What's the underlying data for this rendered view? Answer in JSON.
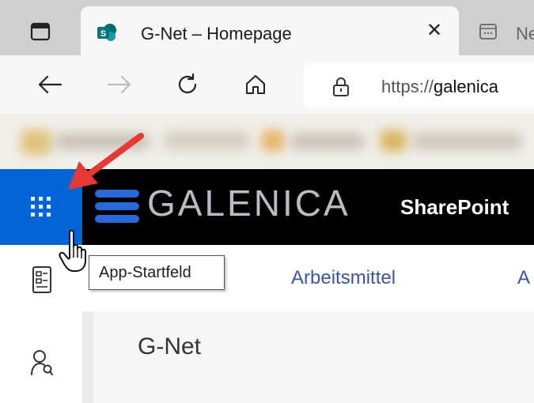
{
  "browser": {
    "tabs": [
      {
        "title": "G-Net – Homepage",
        "favicon": "sharepoint-icon",
        "active": true,
        "close": "✕"
      },
      {
        "title": "Ne",
        "favicon": "form-icon",
        "active": false
      }
    ],
    "address_bar": {
      "scheme": "https://",
      "host": "galenica",
      "icon": "lock-icon"
    },
    "nav_icons": [
      "back-arrow-icon",
      "forward-arrow-icon",
      "refresh-icon",
      "home-icon"
    ]
  },
  "suite_bar": {
    "brand": "GALENICA",
    "app_name": "SharePoint",
    "waffle_icon": "app-launcher-icon",
    "waffle_color": "#0364d6"
  },
  "tooltip": {
    "text": "App-Startfeld"
  },
  "hub_nav": {
    "items": [
      "Arbeitsmittel",
      "A"
    ]
  },
  "site": {
    "title": "G-Net"
  },
  "colors": {
    "suite_bar_bg": "#000000",
    "accent_blue": "#0364d6",
    "nav_link": "#3b55a6",
    "annotation_arrow": "#e53935"
  }
}
